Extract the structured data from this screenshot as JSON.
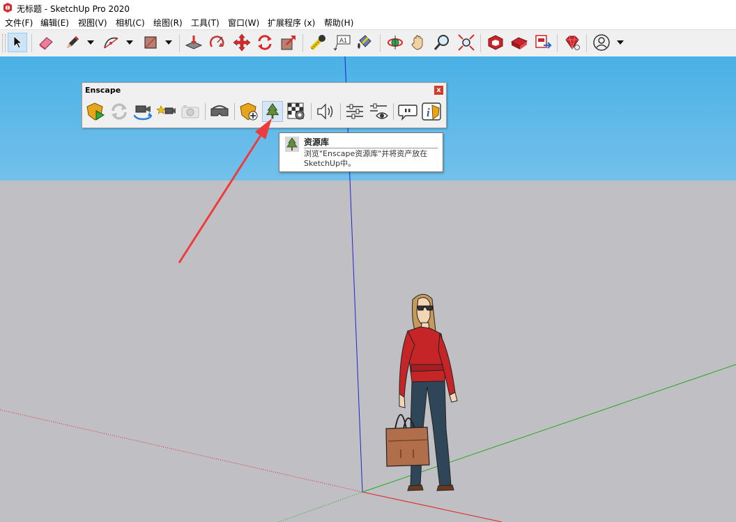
{
  "window": {
    "title": "无标题 - SketchUp Pro 2020"
  },
  "menu": {
    "items": [
      "文件(F)",
      "编辑(E)",
      "视图(V)",
      "相机(C)",
      "绘图(R)",
      "工具(T)",
      "窗口(W)",
      "扩展程序 (x)",
      "帮助(H)"
    ]
  },
  "toolbar": {
    "tools": [
      "select-tool",
      "eraser-tool",
      "pencil-tool",
      "arc-tool",
      "rectangle-tool",
      "push-pull-tool",
      "rotate-tool",
      "move-tool",
      "follow-me-tool",
      "offset-tool",
      "tape-measure-tool",
      "text-tool",
      "paint-bucket-tool",
      "orbit-tool",
      "pan-tool",
      "zoom-tool",
      "zoom-extents-tool",
      "3d-warehouse",
      "extension-warehouse",
      "send-to-layout",
      "extension-manager",
      "account"
    ],
    "active_tool": "select-tool"
  },
  "enscape": {
    "title": "Enscape",
    "close_label": "x",
    "buttons": [
      "start-enscape",
      "live-update",
      "sync-views",
      "create-view",
      "screenshot",
      "vr-headset",
      "capture-object",
      "asset-library",
      "batch-render",
      "sound",
      "settings",
      "visual-settings",
      "feedback",
      "about"
    ],
    "hovered": "asset-library"
  },
  "tooltip": {
    "title": "资源库",
    "description": "浏览\"Enscape资源库\"并将资产放在SketchUp中。"
  },
  "colors": {
    "sky_top": "#4ab1e6",
    "ground": "#c0c0c4",
    "axis_red": "#e02020",
    "axis_green": "#21a821",
    "axis_blue": "#2020d0",
    "annotation_arrow": "#ee3b3b"
  }
}
